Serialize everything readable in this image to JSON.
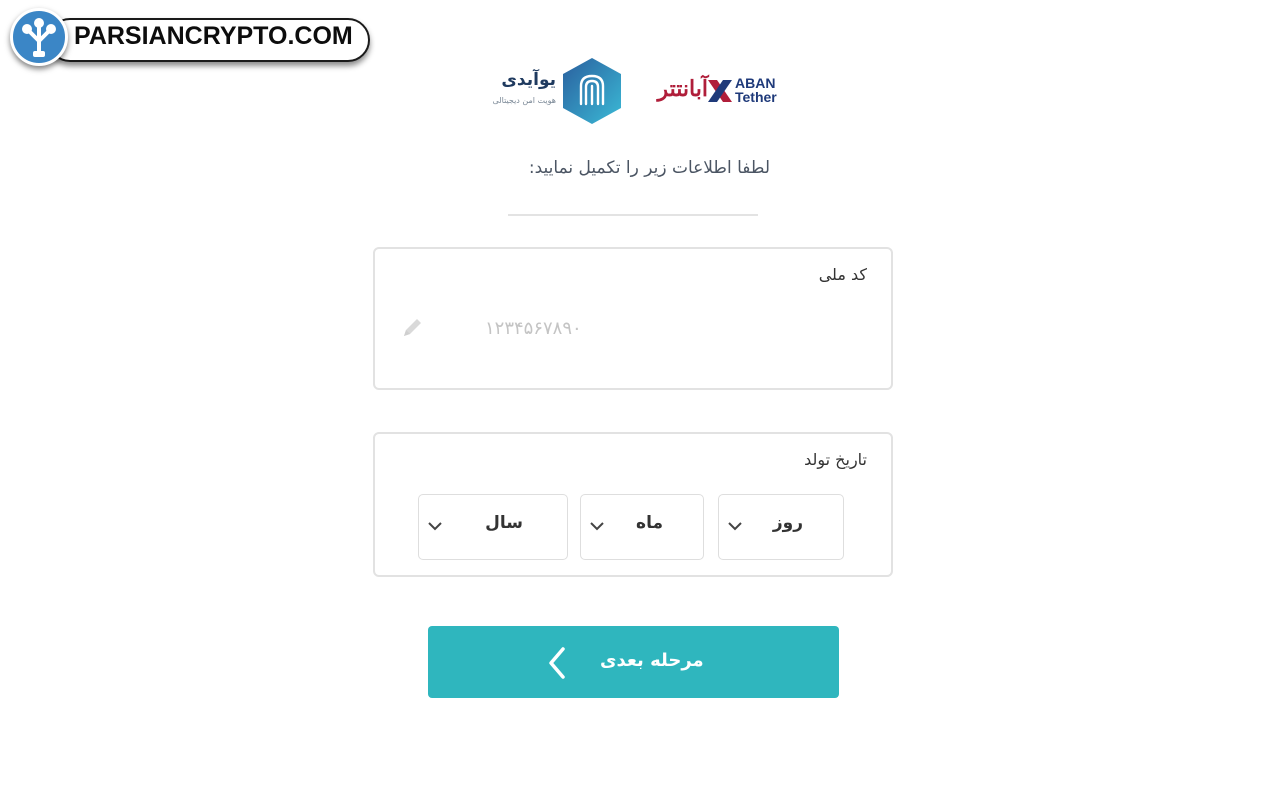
{
  "watermark": {
    "text": "PARSIANCRYPTO.COM"
  },
  "partners": {
    "uid_name": "یوآیدی",
    "uid_tagline": "هویت امن دیجیتالی",
    "aban_fa": "آبانتتر",
    "aban_en_line1": "ABAN",
    "aban_en_line2": "Tether",
    "colors": {
      "aban": "#b01e3a",
      "uid": "#2b7bb9"
    }
  },
  "form": {
    "instruction": "لطفا اطلاعات زیر را تکمیل نمایید:",
    "national_id": {
      "label": "کد ملی",
      "placeholder": "۱۲۳۴۵۶۷۸۹۰"
    },
    "birth_date": {
      "label": "تاریخ تولد",
      "day": "روز",
      "month": "ماه",
      "year": "سال"
    },
    "next_button": "مرحله بعدی",
    "accent_color": "#2fb6be"
  }
}
